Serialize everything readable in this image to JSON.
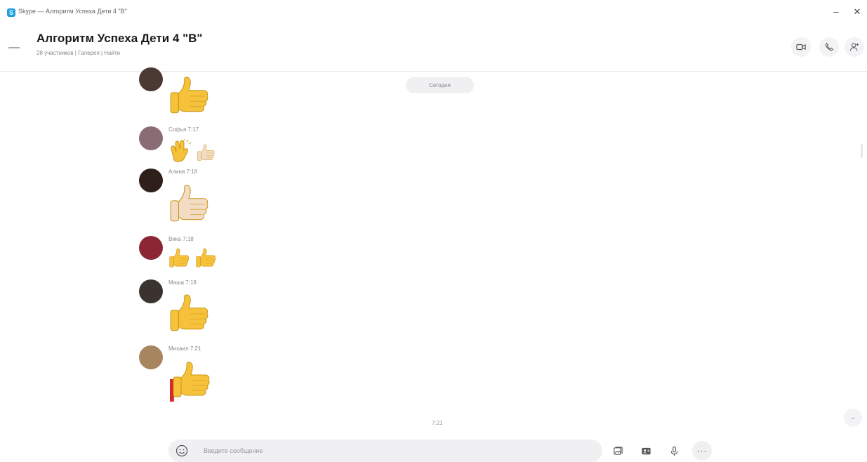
{
  "window": {
    "title": "Skype — Алгоритм Успеха Дети 4 \"В\"",
    "minimize_icon": "minimize-icon",
    "close_icon": "close-icon"
  },
  "header": {
    "title": "Алгоритм Успеха Дети 4 \"В\"",
    "meta": "28 участников | Галерея | Найти",
    "actions": [
      "video-call-icon",
      "audio-call-icon",
      "add-people-icon"
    ]
  },
  "date_divider": "Сегодня",
  "messages": [
    {
      "sender": "",
      "avatar_color": "#4a3a33",
      "emojis": [
        "thumbs-up"
      ]
    },
    {
      "sender": "Софья 7:17",
      "avatar_color": "#8a6d74",
      "emojis": [
        "clapping-hands",
        "thumbs-up-light"
      ]
    },
    {
      "sender": "Алина 7:18",
      "avatar_color": "#2e1f1a",
      "emojis": [
        "thumbs-up-light"
      ]
    },
    {
      "sender": "Вика 7:18",
      "avatar_color": "#8c2634",
      "emojis": [
        "thumbs-up",
        "thumbs-up"
      ]
    },
    {
      "sender": "Маша 7:19",
      "avatar_color": "#3b3330",
      "emojis": [
        "thumbs-up"
      ]
    },
    {
      "sender": "Михаил 7:21",
      "avatar_color": "#a7855f",
      "emojis": [
        "thumbs-up-with-flag"
      ]
    }
  ],
  "typing_text": "7:21",
  "composer": {
    "placeholder": "Введите сообщение"
  },
  "toolbar": [
    "gallery-icon",
    "contact-card-icon",
    "microphone-icon",
    "more-icon"
  ],
  "colors": {
    "accent": "#1ea0e4",
    "emoji_yellow": "#f7c23b",
    "emoji_light": "#f3dcc6",
    "pill_bg": "#f0f0f3"
  }
}
